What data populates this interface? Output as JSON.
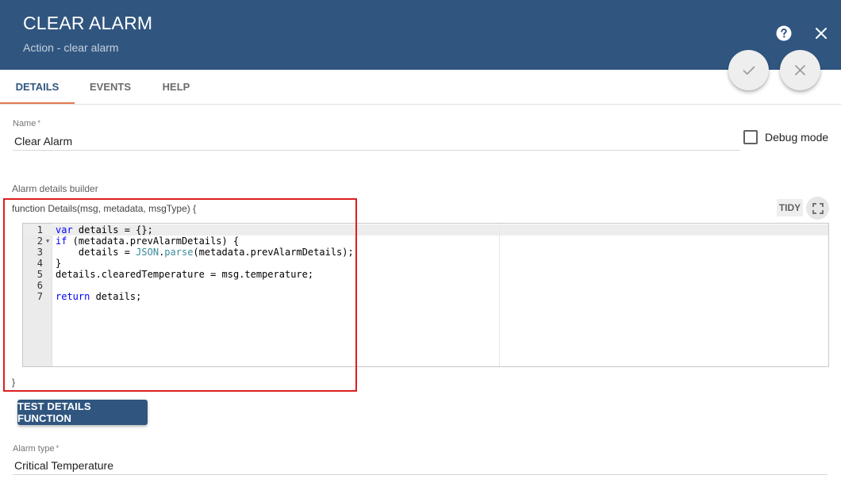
{
  "header": {
    "title": "CLEAR ALARM",
    "subtitle": "Action - clear alarm",
    "help_icon": "help-circle-icon",
    "close_icon": "close-icon"
  },
  "actions": {
    "apply_icon": "check-icon",
    "cancel_icon": "close-icon"
  },
  "tabs": [
    {
      "label": "DETAILS",
      "active": true
    },
    {
      "label": "EVENTS",
      "active": false
    },
    {
      "label": "HELP",
      "active": false
    }
  ],
  "form": {
    "name": {
      "label": "Name",
      "required_mark": "*",
      "value": "Clear Alarm"
    },
    "debug_mode": {
      "label": "Debug mode",
      "checked": false
    },
    "alarm_details_builder": {
      "label": "Alarm details builder",
      "function_header": "function Details(msg, metadata, msgType) {",
      "function_footer": "}",
      "tidy_label": "TIDY",
      "fullscreen_icon": "fullscreen-icon",
      "code_lines": [
        {
          "number": "1",
          "text": "var details = {};"
        },
        {
          "number": "2",
          "text": "if (metadata.prevAlarmDetails) {"
        },
        {
          "number": "3",
          "text": "    details = JSON.parse(metadata.prevAlarmDetails);"
        },
        {
          "number": "4",
          "text": "}"
        },
        {
          "number": "5",
          "text": "details.clearedTemperature = msg.temperature;"
        },
        {
          "number": "6",
          "text": ""
        },
        {
          "number": "7",
          "text": "return details;"
        }
      ]
    },
    "test_button_label": "TEST DETAILS FUNCTION",
    "alarm_type": {
      "label": "Alarm type",
      "required_mark": "*",
      "value": "Critical Temperature"
    }
  },
  "colors": {
    "header_bg": "#305680",
    "tab_ink": "#e07b53",
    "highlight_border": "#dd1f1f",
    "keyword": "#0000ff",
    "builtin": "#3c8b9c"
  }
}
